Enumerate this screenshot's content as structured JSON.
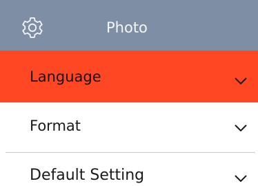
{
  "header": {
    "title": "Photo",
    "icon": "gear-icon",
    "background": "#7e8ea5"
  },
  "menu": {
    "items": [
      {
        "label": "Language",
        "icon": "chevron-down-icon",
        "selected": true
      },
      {
        "label": "Format",
        "icon": "chevron-down-icon",
        "selected": false
      },
      {
        "label": "Default Setting",
        "icon": "chevron-down-icon",
        "selected": false
      }
    ]
  },
  "colors": {
    "selected_background": "#ff4723",
    "text": "#1a1a1a",
    "header_text": "#f4f6fa"
  }
}
